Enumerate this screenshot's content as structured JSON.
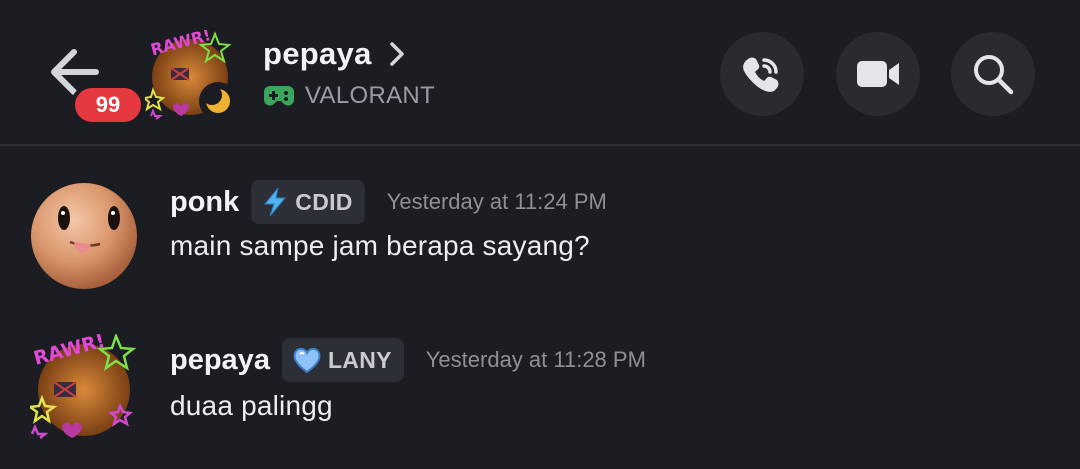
{
  "header": {
    "unread_count": "99",
    "channel_name": "pepaya",
    "activity": "VALORANT",
    "icons": {
      "back": "arrow-left-icon",
      "chevron": "chevron-right-icon",
      "game": "gamepad-icon",
      "call": "phone-call-icon",
      "video": "video-camera-icon",
      "search": "search-icon",
      "status": "moon-idle-icon"
    }
  },
  "messages": [
    {
      "username": "ponk",
      "tag": "CDID",
      "tag_icon": "lightning-icon",
      "timestamp": "Yesterday at 11:24 PM",
      "text": "main sampe jam berapa sayang?"
    },
    {
      "username": "pepaya",
      "tag": "LANY",
      "tag_icon": "blue-heart-icon",
      "timestamp": "Yesterday at 11:28 PM",
      "text": "duaa palingg"
    }
  ],
  "colors": {
    "background": "#1c1d22",
    "badge": "#e5383f",
    "game_icon": "#3ba55d",
    "idle": "#f0b232"
  }
}
